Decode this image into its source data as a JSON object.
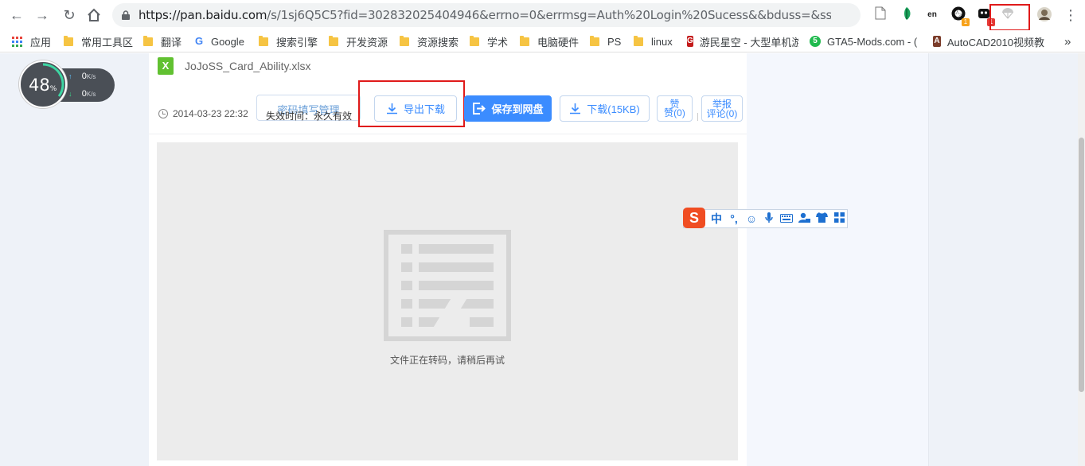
{
  "browser": {
    "url_host": "https://pan.baidu.com",
    "url_rest": "/s/1sj6Q5C5?fid=302832025404946&errno=0&errmsg=Auth%20Login%20Sucess&&bduss=&ssnerror=...",
    "extensions": [
      "page-icon",
      "green-leaf-icon",
      "en-icon",
      "black-circle-icon",
      "robot-icon",
      "parachute-icon",
      "avatar-icon"
    ],
    "ext_badges": [
      "1",
      "1"
    ]
  },
  "bookmarks": [
    {
      "label": "应用",
      "icon": "apps-grid-icon"
    },
    {
      "label": "常用工具区",
      "icon": "folder-icon"
    },
    {
      "label": "翻译",
      "icon": "folder-icon"
    },
    {
      "label": "Google",
      "icon": "google-icon"
    },
    {
      "label": "搜索引擎",
      "icon": "folder-icon"
    },
    {
      "label": "开发资源",
      "icon": "folder-icon"
    },
    {
      "label": "资源搜索",
      "icon": "folder-icon"
    },
    {
      "label": "学术",
      "icon": "folder-icon"
    },
    {
      "label": "电脑硬件",
      "icon": "folder-icon"
    },
    {
      "label": "PS",
      "icon": "folder-icon"
    },
    {
      "label": "linux",
      "icon": "folder-icon"
    },
    {
      "label": "游民星空 - 大型单机游",
      "icon": "gamersky-icon"
    },
    {
      "label": "GTA5-Mods.com - (",
      "icon": "gta5mods-icon"
    },
    {
      "label": "AutoCAD2010视频教",
      "icon": "autocad-icon"
    }
  ],
  "speed": {
    "percent": "48",
    "percent_unit": "%",
    "up_value": "0",
    "down_value": "0",
    "unit": "K/s"
  },
  "file": {
    "icon_letter": "X",
    "name": "JoJoSS_Card_Ability.xlsx",
    "date": "2014-03-23 22:32",
    "expire": "失效时间：永久有效"
  },
  "actions": {
    "password_manage": "密码填写管理",
    "export_download": "导出下载",
    "save_to_disk": "保存到网盘",
    "download": "下载(15KB)",
    "like_top": "赞",
    "like_count": "赞(0)",
    "report": "举报",
    "comment_count": "评论(0)"
  },
  "preview": {
    "message": "文件正在转码，请稍后再试"
  },
  "ime": {
    "logo": "S",
    "items": [
      "中",
      "°,",
      "☺",
      "mic-icon",
      "keyboard-icon",
      "user-icon",
      "shirt-icon",
      "grid-icon"
    ],
    "mode": "中",
    "punct": "°,"
  },
  "colors": {
    "primary": "#3b8cff",
    "highlight_box": "#e01a1a",
    "xlsx_green": "#61c131"
  }
}
